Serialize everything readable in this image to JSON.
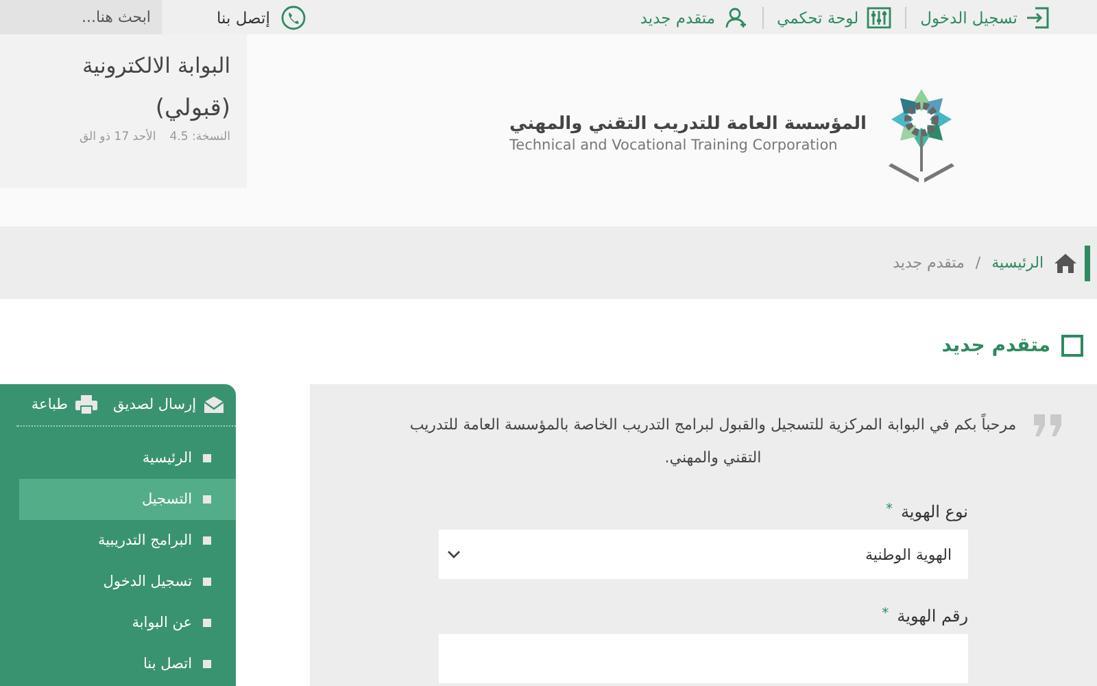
{
  "top_bar": {
    "links": [
      {
        "label": "تسجيل الدخول",
        "kind": "login"
      },
      {
        "label": "لوحة تحكمي",
        "kind": "dashboard"
      },
      {
        "label": "متقدم جديد",
        "kind": "new_user"
      }
    ],
    "contact": "إتصل بنا",
    "search": {
      "placeholder": "ابحث هنا..."
    }
  },
  "header": {
    "org_name_ar": "المؤسسة العامة للتدريب التقني والمهني",
    "org_name_en": "Technical and Vocational Training Corporation",
    "portal_title": "البوابة الالكترونية",
    "portal_subtitle": "(قبولي)",
    "version": "النسخة: 4.5",
    "date": "الأحد 17 ذو الق"
  },
  "breadcrumb": {
    "separator": "/",
    "items": [
      {
        "label": "الرئيسية",
        "kind": "link"
      },
      {
        "label": "متقدم جديد",
        "kind": "current"
      }
    ]
  },
  "page_title": "متقدم جديد",
  "sidebar": {
    "actions": [
      {
        "label": "إرسال لصديق",
        "kind": "email"
      },
      {
        "label": "طباعة",
        "kind": "print"
      }
    ],
    "items": [
      {
        "label": "الرئيسية",
        "selected": false
      },
      {
        "label": "التسجيل",
        "selected": true
      },
      {
        "label": "البرامج التدريبية",
        "selected": false
      },
      {
        "label": "تسجيل الدخول",
        "selected": false
      },
      {
        "label": "عن البوابة",
        "selected": false
      },
      {
        "label": "اتصل بنا",
        "selected": false
      }
    ]
  },
  "form": {
    "intro": "مرحباً بكم في البوابة المركزية للتسجيل والقبول لبرامج التدريب الخاصة بالمؤسسة العامة للتدريب التقني والمهني.",
    "required_mark": "*",
    "fields": [
      {
        "label": "نوع الهوية",
        "required": true,
        "kind": "select",
        "value": "الهوية الوطنية"
      },
      {
        "label": "رقم الهوية",
        "required": true,
        "kind": "text"
      }
    ]
  }
}
